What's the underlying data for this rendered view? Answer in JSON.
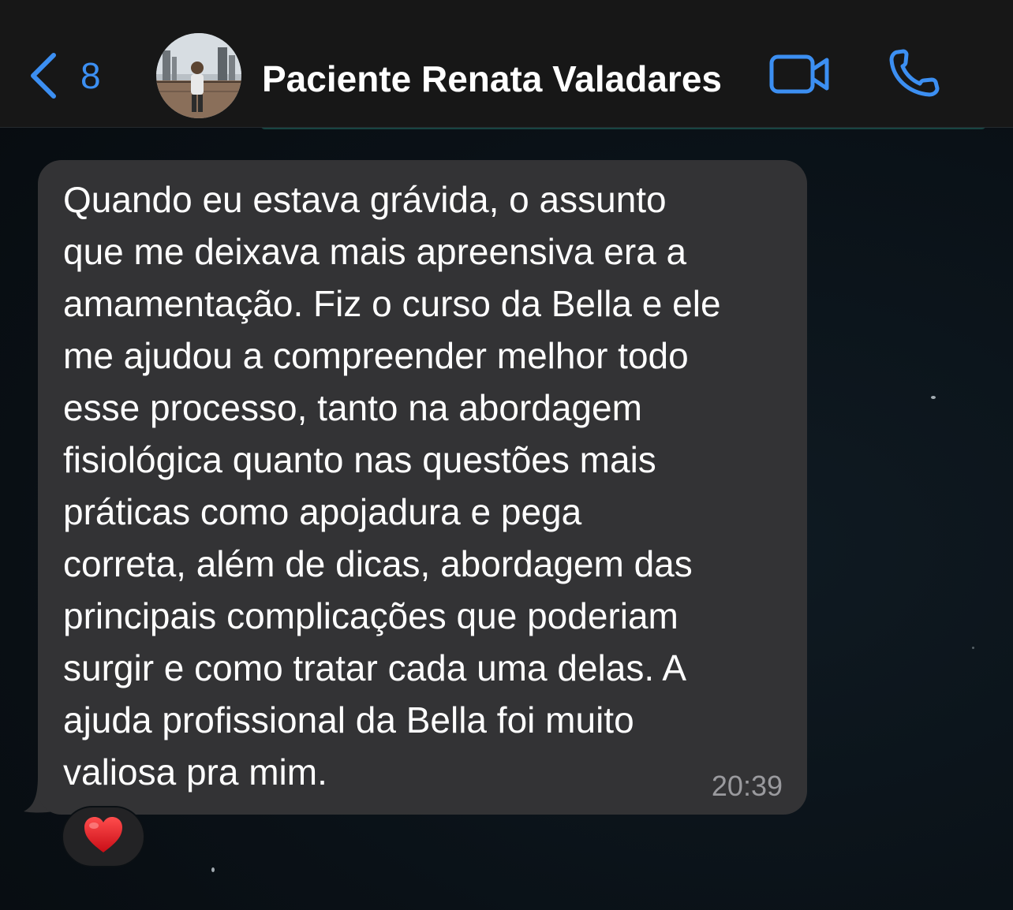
{
  "header": {
    "back_count": "8",
    "contact_name": "Paciente Renata Valadares",
    "icons": {
      "back": "chevron-left-icon",
      "video": "video-camera-icon",
      "call": "phone-icon"
    },
    "accent_color": "#3c8ff2"
  },
  "message": {
    "text": "Quando eu estava grávida, o assunto\nque me deixava mais apreensiva era a\namamentação. Fiz o curso da Bella e ele\nme ajudou a compreender melhor todo\nesse processo, tanto na abordagem\nfisiológica quanto nas questões mais\npráticas como apojadura e pega\ncorreta, além de dicas, abordagem das\nprincipais complicações que poderiam\nsurgir e como tratar cada uma delas. A\najuda profissional da Bella foi muito\nvaliosa pra mim.",
    "time": "20:39",
    "bubble_color": "#333335"
  },
  "reaction": {
    "emoji": "❤️",
    "icon": "heart-icon"
  }
}
